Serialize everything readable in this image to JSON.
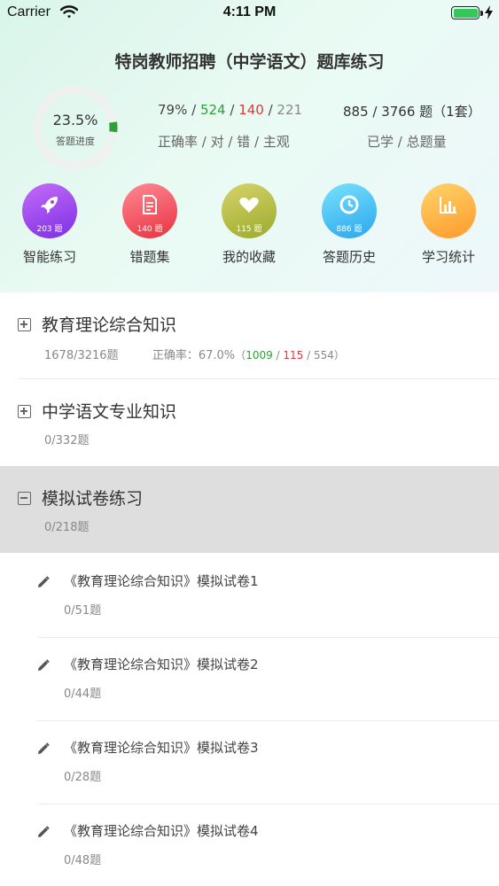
{
  "statusbar": {
    "carrier": "Carrier",
    "time": "4:11 PM"
  },
  "header": {
    "title": "特岗教师招聘（中学语文）题库练习",
    "progress": {
      "percent_text": "23.5%",
      "label": "答题进度",
      "fraction": 0.235
    },
    "accuracy": {
      "rate": "79%",
      "correct": "524",
      "wrong": "140",
      "subjective": "221",
      "label": "正确率 / 对 / 错 / 主观",
      "sep": " / "
    },
    "learned": {
      "text": "885 / 3766 题（1套）",
      "label": "已学 / 总题量"
    }
  },
  "quick_actions": [
    {
      "label": "智能练习",
      "badge": "203 题",
      "icon": "rocket-icon",
      "color_from": "#c46cf7",
      "color_to": "#7c2fe6"
    },
    {
      "label": "错题集",
      "badge": "140 题",
      "icon": "document-icon",
      "color_from": "#ff8a95",
      "color_to": "#e8323f"
    },
    {
      "label": "我的收藏",
      "badge": "115 题",
      "icon": "heart-icon",
      "color_from": "#d6d36a",
      "color_to": "#9bab2c"
    },
    {
      "label": "答题历史",
      "badge": "886 题",
      "icon": "history-icon",
      "color_from": "#79e2fb",
      "color_to": "#2aa6ef"
    },
    {
      "label": "学习统计",
      "badge": "",
      "icon": "bar-chart-icon",
      "color_from": "#ffd46b",
      "color_to": "#ff9a2a"
    }
  ],
  "categories": [
    {
      "name": "教育理论综合知识",
      "count": "1678/3216题",
      "accuracy_label": "正确率：",
      "accuracy": "67.0%",
      "open": "（",
      "correct": "1009",
      "wrong": "115",
      "other": "554",
      "close": "）",
      "sep": " / ",
      "expanded": false
    },
    {
      "name": "中学语文专业知识",
      "count": "0/332题",
      "expanded": false
    },
    {
      "name": "模拟试卷练习",
      "count": "0/218题",
      "expanded": true
    }
  ],
  "papers": [
    {
      "name": "《教育理论综合知识》模拟试卷1",
      "count": "0/51题"
    },
    {
      "name": "《教育理论综合知识》模拟试卷2",
      "count": "0/44题"
    },
    {
      "name": "《教育理论综合知识》模拟试卷3",
      "count": "0/28题"
    },
    {
      "name": "《教育理论综合知识》模拟试卷4",
      "count": "0/48题"
    }
  ],
  "colors": {
    "ring_progress": "#2e9e3a",
    "ring_track": "#eef1f0",
    "correct": "#2e9e3a",
    "wrong": "#e0363c"
  }
}
